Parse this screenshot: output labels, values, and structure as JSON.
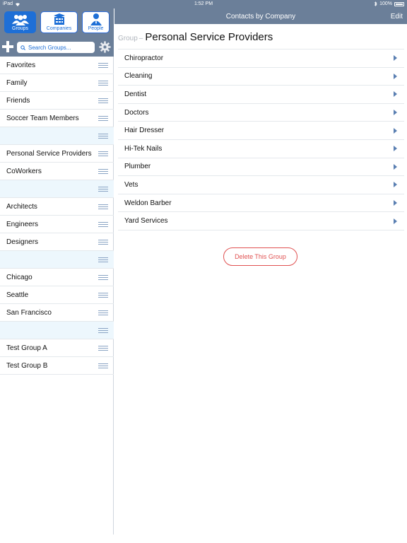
{
  "status_bar": {
    "device": "iPad",
    "time": "1:52 PM",
    "battery": "100%"
  },
  "nav": {
    "title": "Contacts by Company",
    "edit_label": "Edit"
  },
  "segments": [
    {
      "label": "Groups",
      "icon": "groups-icon",
      "active": true
    },
    {
      "label": "Companies",
      "icon": "companies-icon",
      "active": false
    },
    {
      "label": "People",
      "icon": "people-icon",
      "active": false
    }
  ],
  "search": {
    "placeholder": "Search Groups..."
  },
  "groups": [
    {
      "label": "Favorites"
    },
    {
      "label": "Family"
    },
    {
      "label": "Friends"
    },
    {
      "label": "Soccer Team Members"
    },
    {
      "label": ""
    },
    {
      "label": "Personal Service Providers"
    },
    {
      "label": "CoWorkers"
    },
    {
      "label": ""
    },
    {
      "label": "Architects"
    },
    {
      "label": "Engineers"
    },
    {
      "label": "Designers"
    },
    {
      "label": ""
    },
    {
      "label": "Chicago"
    },
    {
      "label": "Seattle"
    },
    {
      "label": "San Francisco"
    },
    {
      "label": ""
    },
    {
      "label": "Test Group A"
    },
    {
      "label": "Test Group B"
    }
  ],
  "detail": {
    "prefix": "Group",
    "separator": "–",
    "title": "Personal Service Providers",
    "items": [
      {
        "label": "Chiropractor"
      },
      {
        "label": "Cleaning"
      },
      {
        "label": "Dentist"
      },
      {
        "label": "Doctors"
      },
      {
        "label": "Hair Dresser"
      },
      {
        "label": "Hi-Tek Nails"
      },
      {
        "label": "Plumber"
      },
      {
        "label": "Vets"
      },
      {
        "label": "Weldon Barber"
      },
      {
        "label": "Yard Services"
      }
    ],
    "delete_label": "Delete This Group"
  },
  "colors": {
    "bar": "#6b7f99",
    "accent": "#1e6fd6",
    "separator_row": "#edf7fd",
    "delete": "#e05252"
  }
}
